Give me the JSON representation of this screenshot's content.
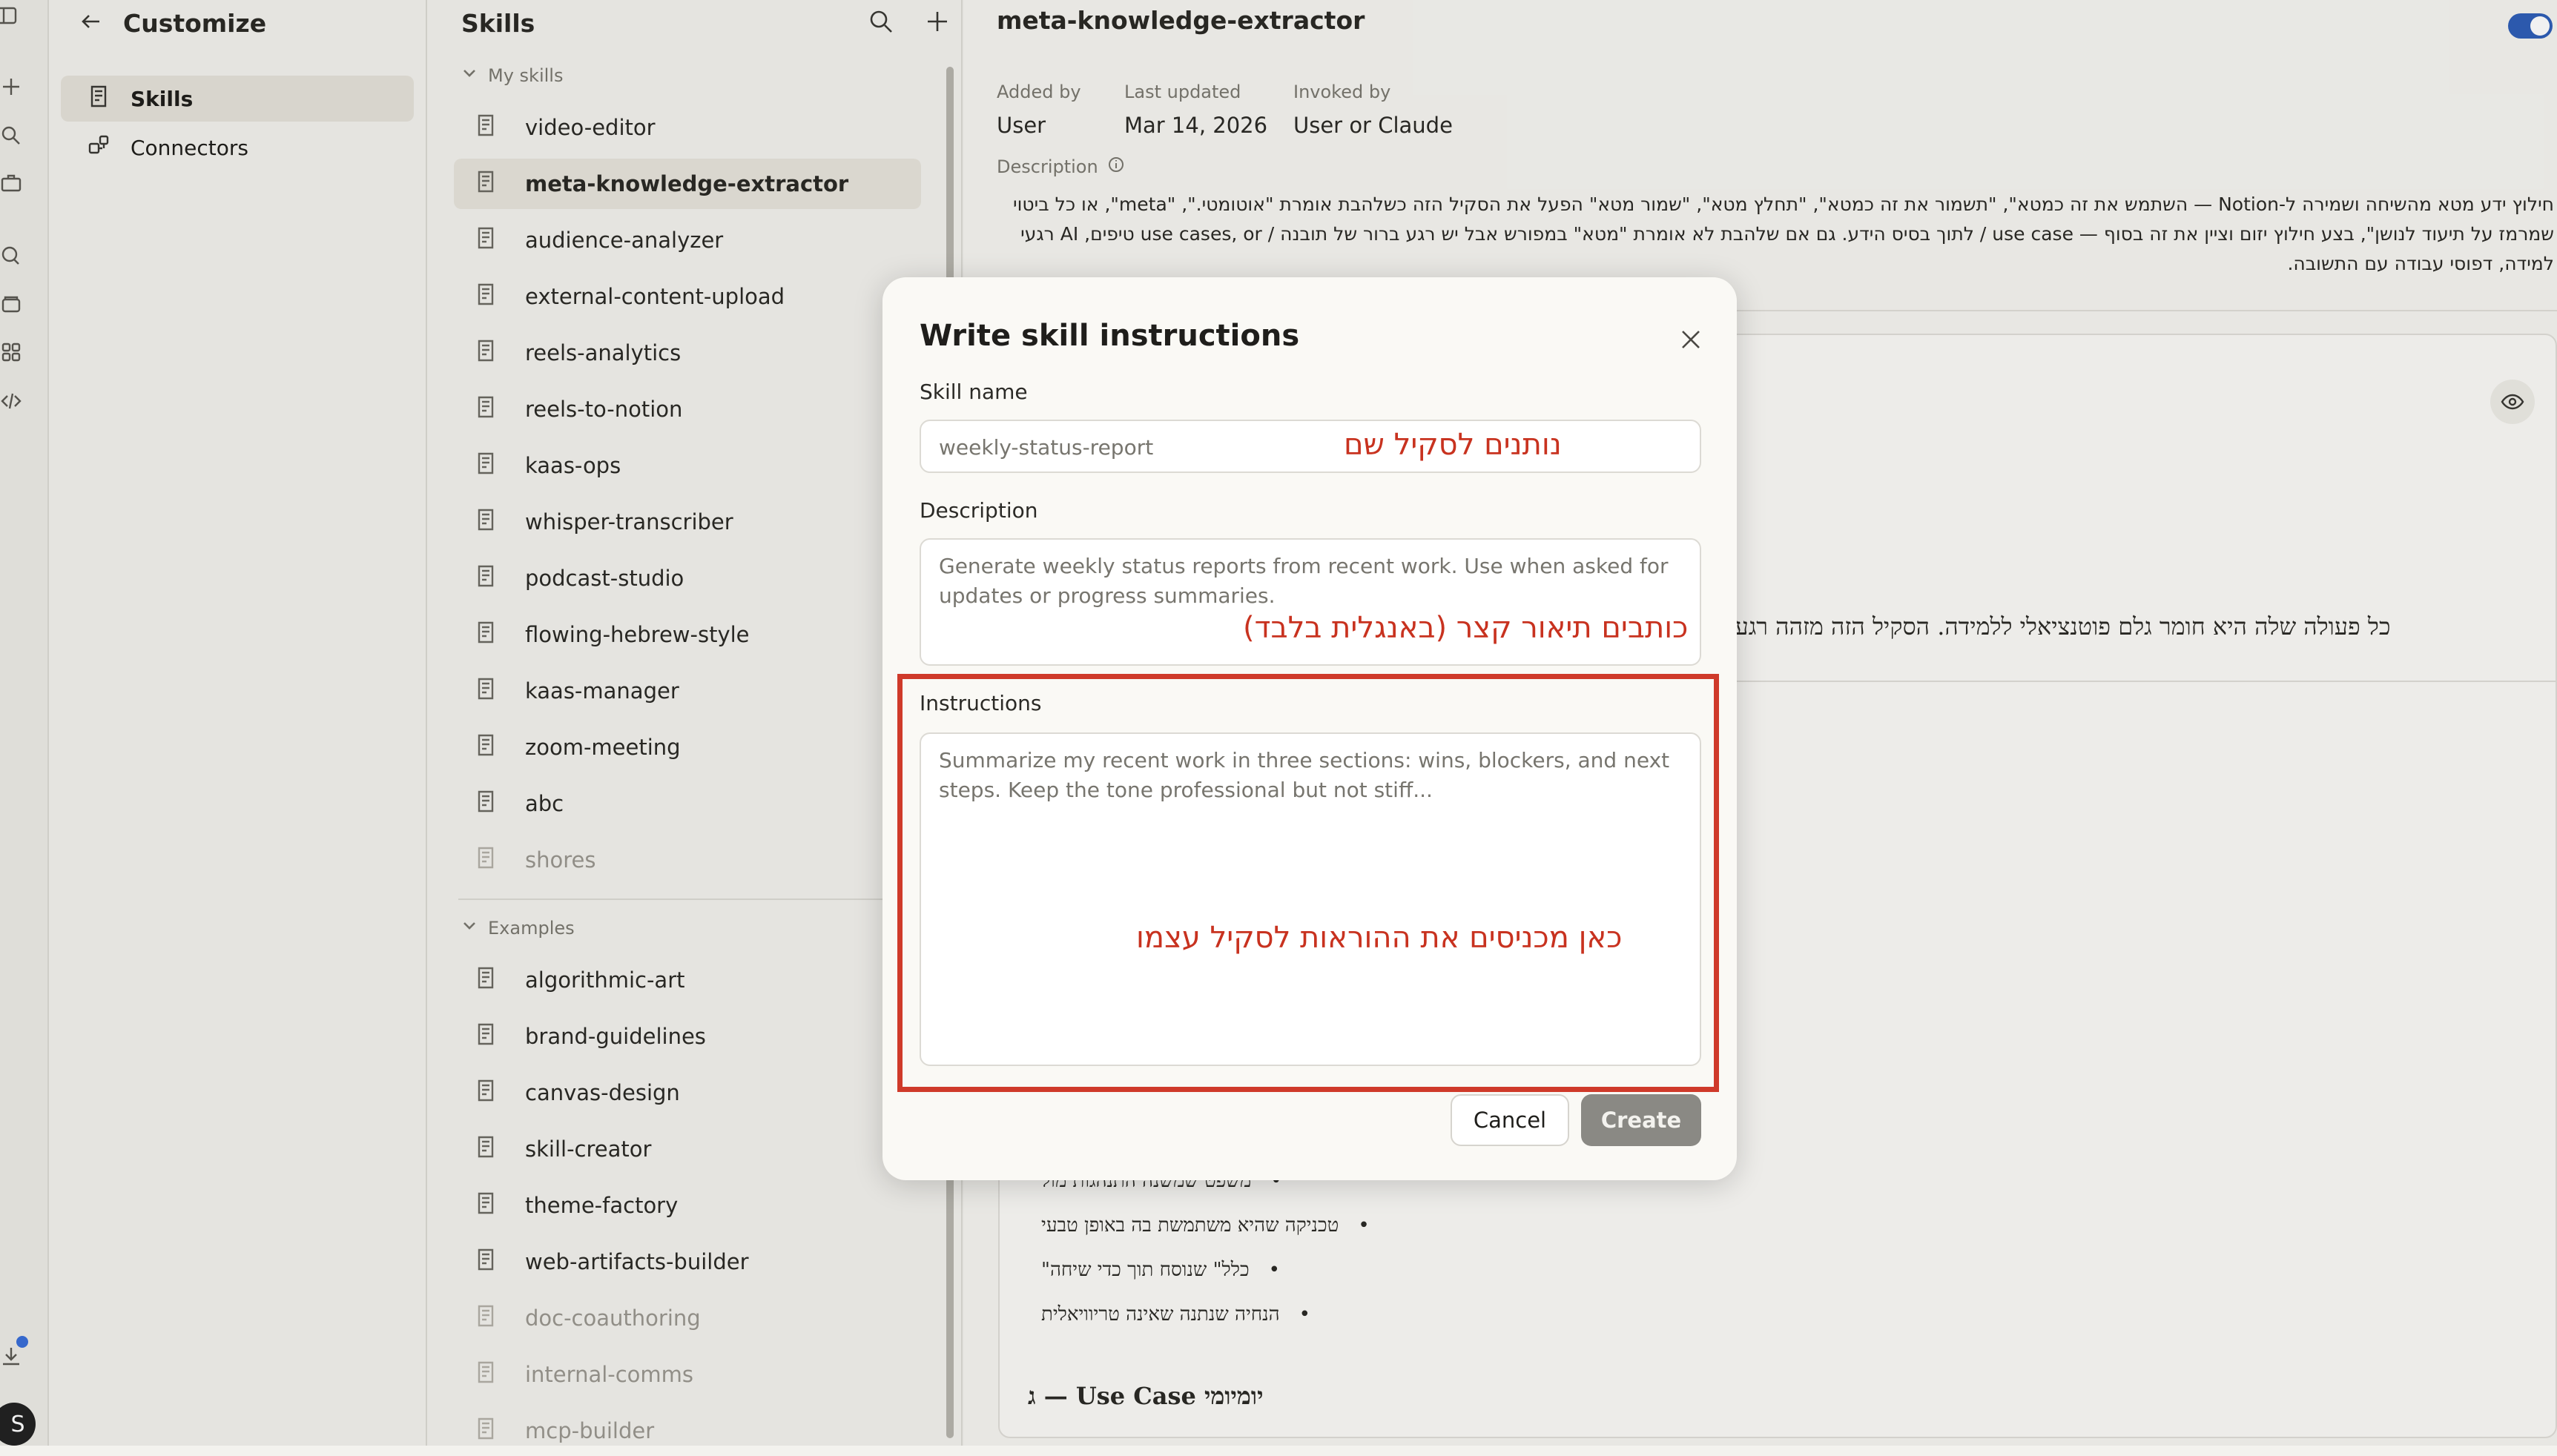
{
  "customize": {
    "title": "Customize",
    "nav": [
      {
        "label": "Skills"
      },
      {
        "label": "Connectors"
      }
    ]
  },
  "skills": {
    "title": "Skills",
    "my_skills_label": "My skills",
    "my_skills": [
      "video-editor",
      "meta-knowledge-extractor",
      "audience-analyzer",
      "external-content-upload",
      "reels-analytics",
      "reels-to-notion",
      "kaas-ops",
      "whisper-transcriber",
      "podcast-studio",
      "flowing-hebrew-style",
      "kaas-manager",
      "zoom-meeting",
      "abc",
      "shores"
    ],
    "examples_label": "Examples",
    "examples": [
      "algorithmic-art",
      "brand-guidelines",
      "canvas-design",
      "skill-creator",
      "theme-factory",
      "web-artifacts-builder",
      "doc-coauthoring",
      "internal-comms",
      "mcp-builder"
    ]
  },
  "detail": {
    "title": "meta-knowledge-extractor",
    "added_by_label": "Added by",
    "added_by": "User",
    "last_updated_label": "Last updated",
    "last_updated": "Mar 14, 2026",
    "invoked_by_label": "Invoked by",
    "invoked_by": "User or Claude",
    "description_label": "Description",
    "description": "חילוץ ידע מטא מהשיחה ושמירה ל-Notion — השתמש את זה כמטא\", \"תשמור את זה כמטא\", \"תחלץ מטא\", \"שמור מטא\" הפעל את הסקיל הזה כשלהבת אומרת \"אוטומטי.\", \"meta\", או כל ביטוי שמרמז על תיעוד לנושן\", בצע חילוץ יזום וציין את זה בסוף — use case / לתוך בסיס הידע. גם אם שלהבת לא אומרת \"מטא\" במפורש אבל יש רגע ברור של תובנה / use cases, or טיפים, AI רגעי למידה, דפוסי עבודה עם התשובה.",
    "paragraph": "כל פעולה שלה היא חומר גלם פוטנציאלי ללמידה. הסקיל הזה מזהה רגעי-Notion.",
    "bullets": [
      "משפט שמשנה התנהגות מול",
      "טכניקה שהיא משתמשת בה באופן טבעי",
      "כלל\" שנוסח תוך כדי שיחה\"",
      "הנחיה שנתנה שאינה טריוויאלית"
    ],
    "heading": "ג — Use Case יומיומי"
  },
  "modal": {
    "title": "Write skill instructions",
    "skill_name_label": "Skill name",
    "skill_name_placeholder": "weekly-status-report",
    "description_label": "Description",
    "description_placeholder": "Generate weekly status reports from recent work. Use when asked for updates or progress summaries.",
    "instructions_label": "Instructions",
    "instructions_placeholder": "Summarize my recent work in three sections: wins, blockers, and next steps. Keep the tone professional but not stiff...",
    "cancel_label": "Cancel",
    "create_label": "Create"
  },
  "annotations": {
    "name_note": "נותנים לסקיל שם",
    "description_note": "כותבים תיאור קצר (באנגלית בלבד)",
    "instructions_note": "כאן מכניסים את ההוראות לסקיל עצמו"
  },
  "colors": {
    "annotation_red": "#cf3a2a",
    "toggle_blue": "#2f5fb8",
    "create_disabled": "#8a8984"
  },
  "user": {
    "initial": "S"
  }
}
